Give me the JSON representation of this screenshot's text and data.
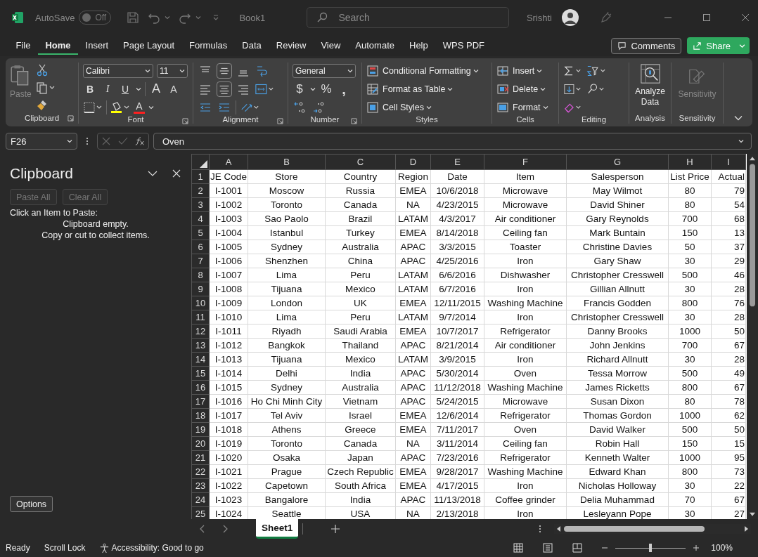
{
  "title_bar": {
    "autosave_label": "AutoSave",
    "autosave": {
      "on": false,
      "label": "Off"
    },
    "document": "Book1",
    "search": {
      "placeholder": "Search"
    },
    "user": "Srishti"
  },
  "menu_tabs": [
    {
      "label": "File",
      "selected": false
    },
    {
      "label": "Home",
      "selected": true
    },
    {
      "label": "Insert",
      "selected": false
    },
    {
      "label": "Page Layout",
      "selected": false
    },
    {
      "label": "Formulas",
      "selected": false
    },
    {
      "label": "Data",
      "selected": false
    },
    {
      "label": "Review",
      "selected": false
    },
    {
      "label": "View",
      "selected": false
    },
    {
      "label": "Automate",
      "selected": false
    },
    {
      "label": "Help",
      "selected": false
    },
    {
      "label": "WPS PDF",
      "selected": false
    }
  ],
  "comments_button": "Comments",
  "share_button": "Share",
  "ribbon": {
    "clipboard": {
      "label": "Clipboard",
      "paste": {
        "label": "Paste",
        "disabled": true
      }
    },
    "font": {
      "label": "Font",
      "font_name": "Calibri",
      "font_size": "11",
      "bold": "B",
      "italic": "I",
      "underline": "U",
      "grow": "A",
      "shrink": "A",
      "font_color": "A"
    },
    "alignment": {
      "label": "Alignment"
    },
    "number": {
      "label": "Number",
      "format": "General",
      "currency": "$",
      "percent": "%",
      "comma": ","
    },
    "styles": {
      "label": "Styles",
      "items": [
        "Conditional Formatting",
        "Format as Table",
        "Cell Styles"
      ]
    },
    "cells": {
      "label": "Cells",
      "items": [
        "Insert",
        "Delete",
        "Format"
      ]
    },
    "editing": {
      "label": "Editing"
    },
    "analysis": {
      "label": "Analysis",
      "button": "Analyze Data"
    },
    "sensitivity": {
      "label": "Sensitivity",
      "button": {
        "label": "Sensitivity",
        "disabled": true
      }
    }
  },
  "formula_bar": {
    "name_box": "F26",
    "value": "Oven"
  },
  "clipboard_pane": {
    "title": "Clipboard",
    "buttons": [
      {
        "label": "Paste All",
        "disabled": true
      },
      {
        "label": "Clear All",
        "disabled": true
      }
    ],
    "instruction": "Click an Item to Paste:",
    "empty_lines": [
      "Clipboard empty.",
      "Copy or cut to collect items."
    ],
    "options": "Options"
  },
  "sheet": {
    "columns": [
      "A",
      "B",
      "C",
      "D",
      "E",
      "F",
      "G",
      "H",
      "I"
    ],
    "rows": [
      {
        "number": "1",
        "cells": [
          "JE Code",
          "Store",
          "Country",
          "Region",
          "Date",
          "Item",
          "Salesperson",
          "List Price",
          "Actual"
        ]
      },
      {
        "number": "2",
        "cells": [
          "I-1001",
          "Moscow",
          "Russia",
          "EMEA",
          "10/6/2018",
          "Microwave",
          "May Wilmot",
          "80",
          "79"
        ]
      },
      {
        "number": "3",
        "cells": [
          "I-1002",
          "Toronto",
          "Canada",
          "NA",
          "4/23/2015",
          "Microwave",
          "David Shiner",
          "80",
          "54"
        ]
      },
      {
        "number": "4",
        "cells": [
          "I-1003",
          "Sao Paolo",
          "Brazil",
          "LATAM",
          "4/3/2017",
          "Air conditioner",
          "Gary Reynolds",
          "700",
          "68"
        ]
      },
      {
        "number": "5",
        "cells": [
          "I-1004",
          "Istanbul",
          "Turkey",
          "EMEA",
          "8/14/2018",
          "Ceiling fan",
          "Mark Buntain",
          "150",
          "13"
        ]
      },
      {
        "number": "6",
        "cells": [
          "I-1005",
          "Sydney",
          "Australia",
          "APAC",
          "3/3/2015",
          "Toaster",
          "Christine Davies",
          "50",
          "37"
        ]
      },
      {
        "number": "7",
        "cells": [
          "I-1006",
          "Shenzhen",
          "China",
          "APAC",
          "4/25/2016",
          "Iron",
          "Gary Shaw",
          "30",
          "29"
        ]
      },
      {
        "number": "8",
        "cells": [
          "I-1007",
          "Lima",
          "Peru",
          "LATAM",
          "6/6/2016",
          "Dishwasher",
          "Christopher Cresswell",
          "500",
          "46"
        ]
      },
      {
        "number": "9",
        "cells": [
          "I-1008",
          "Tijuana",
          "Mexico",
          "LATAM",
          "6/7/2016",
          "Iron",
          "Gillian Allnutt",
          "30",
          "28"
        ]
      },
      {
        "number": "10",
        "cells": [
          "I-1009",
          "London",
          "UK",
          "EMEA",
          "12/11/2015",
          "Washing Machine",
          "Francis Godden",
          "800",
          "76"
        ]
      },
      {
        "number": "11",
        "cells": [
          "I-1010",
          "Lima",
          "Peru",
          "LATAM",
          "9/7/2014",
          "Iron",
          "Christopher Cresswell",
          "30",
          "28"
        ]
      },
      {
        "number": "12",
        "cells": [
          "I-1011",
          "Riyadh",
          "Saudi Arabia",
          "EMEA",
          "10/7/2017",
          "Refrigerator",
          "Danny Brooks",
          "1000",
          "50"
        ]
      },
      {
        "number": "13",
        "cells": [
          "I-1012",
          "Bangkok",
          "Thailand",
          "APAC",
          "8/21/2014",
          "Air conditioner",
          "John Jenkins",
          "700",
          "67"
        ]
      },
      {
        "number": "14",
        "cells": [
          "I-1013",
          "Tijuana",
          "Mexico",
          "LATAM",
          "3/9/2015",
          "Iron",
          "Richard Allnutt",
          "30",
          "28"
        ]
      },
      {
        "number": "15",
        "cells": [
          "I-1014",
          "Delhi",
          "India",
          "APAC",
          "5/30/2014",
          "Oven",
          "Tessa Morrow",
          "500",
          "49"
        ]
      },
      {
        "number": "16",
        "cells": [
          "I-1015",
          "Sydney",
          "Australia",
          "APAC",
          "11/12/2018",
          "Washing Machine",
          "James Ricketts",
          "800",
          "67"
        ]
      },
      {
        "number": "17",
        "cells": [
          "I-1016",
          "Ho Chi Minh City",
          "Vietnam",
          "APAC",
          "5/24/2015",
          "Microwave",
          "Susan Dixon",
          "80",
          "78"
        ]
      },
      {
        "number": "18",
        "cells": [
          "I-1017",
          "Tel Aviv",
          "Israel",
          "EMEA",
          "12/6/2014",
          "Refrigerator",
          "Thomas Gordon",
          "1000",
          "62"
        ]
      },
      {
        "number": "19",
        "cells": [
          "I-1018",
          "Athens",
          "Greece",
          "EMEA",
          "7/11/2017",
          "Oven",
          "David Walker",
          "500",
          "50"
        ]
      },
      {
        "number": "20",
        "cells": [
          "I-1019",
          "Toronto",
          "Canada",
          "NA",
          "3/11/2014",
          "Ceiling fan",
          "Robin Hall",
          "150",
          "15"
        ]
      },
      {
        "number": "21",
        "cells": [
          "I-1020",
          "Osaka",
          "Japan",
          "APAC",
          "7/23/2016",
          "Refrigerator",
          "Kenneth Walter",
          "1000",
          "95"
        ]
      },
      {
        "number": "22",
        "cells": [
          "I-1021",
          "Prague",
          "Czech Republic",
          "EMEA",
          "9/28/2017",
          "Washing Machine",
          "Edward Khan",
          "800",
          "73"
        ]
      },
      {
        "number": "23",
        "cells": [
          "I-1022",
          "Capetown",
          "South Africa",
          "EMEA",
          "4/17/2015",
          "Iron",
          "Nicholas Holloway",
          "30",
          "22"
        ]
      },
      {
        "number": "24",
        "cells": [
          "I-1023",
          "Bangalore",
          "India",
          "APAC",
          "11/13/2018",
          "Coffee grinder",
          "Delia Muhammad",
          "70",
          "67"
        ]
      },
      {
        "number": "25",
        "cells": [
          "I-1024",
          "Seattle",
          "USA",
          "NA",
          "2/13/2018",
          "Iron",
          "Lesleyann Pope",
          "30",
          "27"
        ]
      }
    ]
  },
  "sheet_tabs": [
    {
      "label": "Sheet1",
      "selected": true
    }
  ],
  "status_bar": {
    "items": [
      "Ready",
      "Scroll Lock"
    ],
    "accessibility": "Accessibility: Good to go",
    "zoom": {
      "level": 0.5,
      "label": "100%"
    }
  }
}
